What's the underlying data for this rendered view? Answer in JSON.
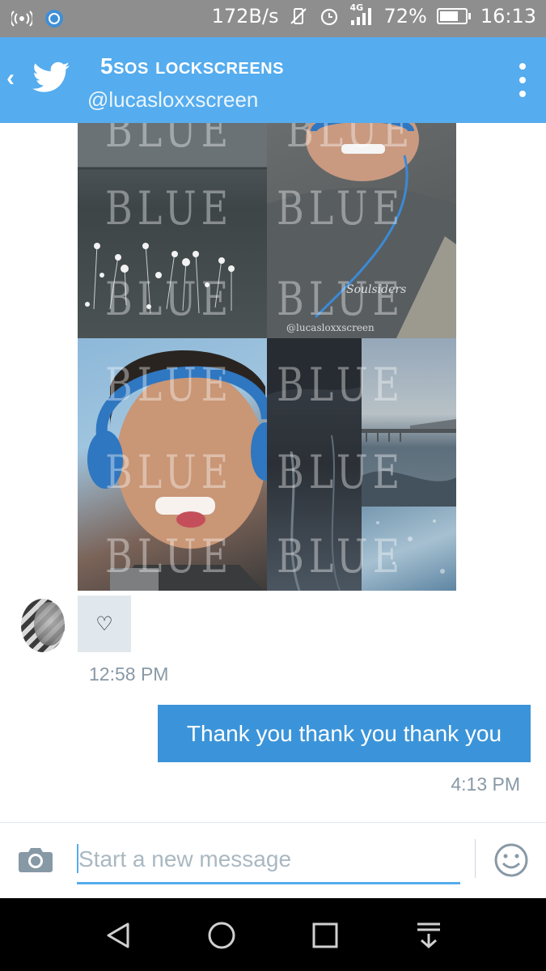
{
  "status_bar": {
    "net_speed": "172B/s",
    "network_type": "4G",
    "battery_percent": "72%",
    "battery_level": 0.72,
    "time": "16:13",
    "icons": [
      "broadcast-icon",
      "app-icon",
      "vibrate-off-icon",
      "alarm-icon",
      "signal-icon",
      "battery-icon"
    ]
  },
  "header": {
    "back_icon": "‹",
    "title": "5sos lockscreens",
    "handle": "@lucasloxxscreen",
    "accent": "#55acee"
  },
  "conversation": {
    "image": {
      "watermark_word": "BLUE",
      "credit": "@lucasloxxscreen",
      "signature": "Soulsiders"
    },
    "incoming": {
      "reaction": "♡",
      "time": "12:58 PM"
    },
    "outgoing": {
      "text": "Thank you thank you thank you",
      "time": "4:13 PM",
      "bubble_color": "#3b94d9"
    }
  },
  "composer": {
    "placeholder": "Start a new message"
  },
  "nav_bar": {
    "icons": [
      "back-nav-icon",
      "home-nav-icon",
      "recents-nav-icon",
      "notification-pull-icon"
    ]
  }
}
